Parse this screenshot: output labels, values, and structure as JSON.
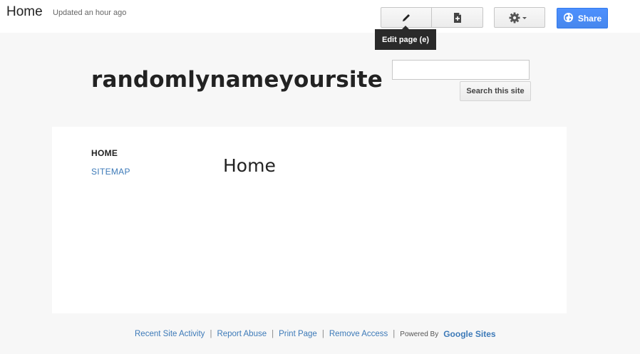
{
  "header": {
    "page_name": "Home",
    "updated": "Updated an hour ago",
    "edit_tooltip": "Edit page (e)",
    "share_label": "Share"
  },
  "site": {
    "title": "randomlynameyoursite",
    "search_placeholder": "",
    "search_button": "Search this site"
  },
  "nav": {
    "items": [
      {
        "label": "HOME"
      },
      {
        "label": "SITEMAP"
      }
    ]
  },
  "main": {
    "heading": "Home"
  },
  "footer": {
    "links": [
      "Recent Site Activity",
      "Report Abuse",
      "Print Page",
      "Remove Access"
    ],
    "separator": "|",
    "powered_by": "Powered By",
    "brand": "Google Sites"
  },
  "colors": {
    "accent": "#4d90fe",
    "link": "#3d7ab8",
    "tooltip_bg": "#2a2a2a"
  },
  "icons": {
    "edit": "pencil-icon",
    "new_page": "new-page-icon",
    "settings": "gear-icon",
    "share": "globe-icon"
  }
}
